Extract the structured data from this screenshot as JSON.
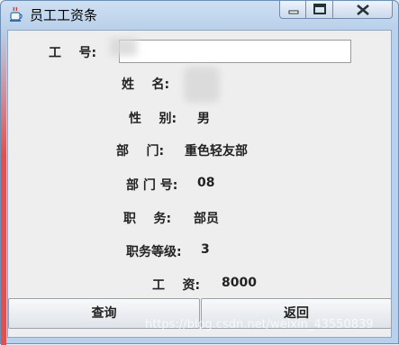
{
  "window": {
    "title": "员工工资条"
  },
  "icons": {
    "app": "java-cup-icon",
    "minimize": "minimize-icon",
    "maximize": "maximize-icon",
    "close": "close-icon"
  },
  "form": {
    "id_label": "工    号:",
    "id_value": "",
    "name_label": "姓    名:",
    "name_value": "",
    "gender_label": "性    别:",
    "gender_value": "男",
    "dept_label": "部    门:",
    "dept_value": "重色轻友部",
    "dept_no_label": "部 门 号:",
    "dept_no_value": "08",
    "position_label": "职    务:",
    "position_value": "部员",
    "grade_label": "职务等级:",
    "grade_value": "3",
    "salary_label": "工    资:",
    "salary_value": "8000"
  },
  "buttons": {
    "query": "查询",
    "back": "返回"
  },
  "watermark": "https://blog.csdn.net/weixin_43550839"
}
